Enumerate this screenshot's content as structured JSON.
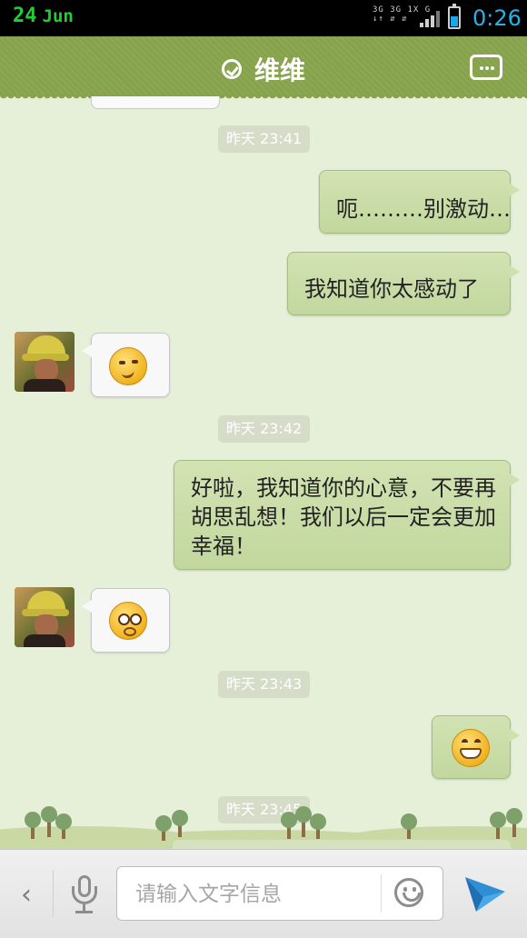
{
  "status_bar": {
    "day": "24",
    "month": "Jun",
    "network_line1": "3G 3G 1X  G",
    "network_line2": "↓↑ ⇵ ⇵",
    "time": "0:26",
    "battery_level": 0.5
  },
  "header": {
    "title": "维维",
    "verified_icon": "check-circle-icon",
    "menu_icon": "more-dots-icon"
  },
  "messages": [
    {
      "type": "timestamp",
      "text": "昨天 23:41"
    },
    {
      "type": "out",
      "text": "呃………别激动…"
    },
    {
      "type": "out",
      "text": "我知道你太感动了"
    },
    {
      "type": "in",
      "emoji": "smirk-emoji"
    },
    {
      "type": "timestamp",
      "text": "昨天 23:42"
    },
    {
      "type": "out",
      "text": "好啦，我知道你的心意，不要再胡思乱想！我们以后一定会更加幸福！"
    },
    {
      "type": "in",
      "emoji": "pleading-emoji"
    },
    {
      "type": "timestamp",
      "text": "昨天 23:43"
    },
    {
      "type": "out",
      "emoji": "grin-emoji"
    },
    {
      "type": "timestamp",
      "text": "昨天 23:45"
    }
  ],
  "input_bar": {
    "back_icon": "chevron-left-icon",
    "mic_icon": "microphone-icon",
    "placeholder": "请输入文字信息",
    "value": "",
    "emoji_icon": "smiley-icon",
    "send_icon": "send-arrow-icon"
  },
  "colors": {
    "header_green": "#86a34c",
    "chat_background": "#e6efd8",
    "outgoing_bubble": "#c8dca6",
    "incoming_bubble": "#f8f8f8",
    "time_blue": "#27b1ec",
    "date_green": "#1fd12a"
  }
}
